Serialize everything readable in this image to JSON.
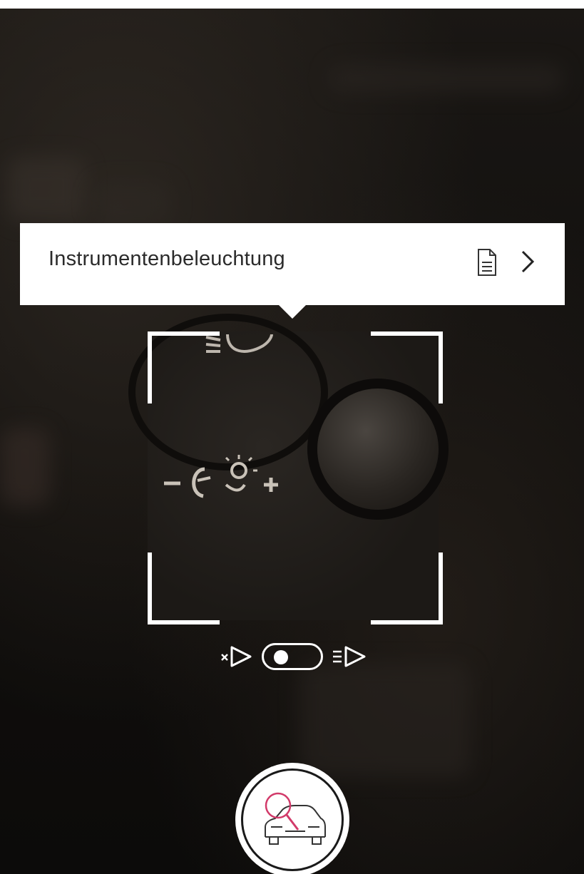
{
  "info_card": {
    "title": "Instrumentenbeleuchtung",
    "doc_icon": "document-icon",
    "chevron_icon": "chevron-right-icon"
  },
  "scanner": {
    "detected_control": "instrument-lighting-dial",
    "symbols": "− ☀ +"
  },
  "light_toggle": {
    "left_icon": "flashlight-off-icon",
    "right_icon": "flashlight-on-icon",
    "state": "off"
  },
  "scan_button": {
    "icon": "car-magnifier-icon"
  },
  "colors": {
    "card_background": "#ffffff",
    "frame": "#ffffff",
    "accent": "#d23a6a",
    "background": "#100e0c"
  }
}
